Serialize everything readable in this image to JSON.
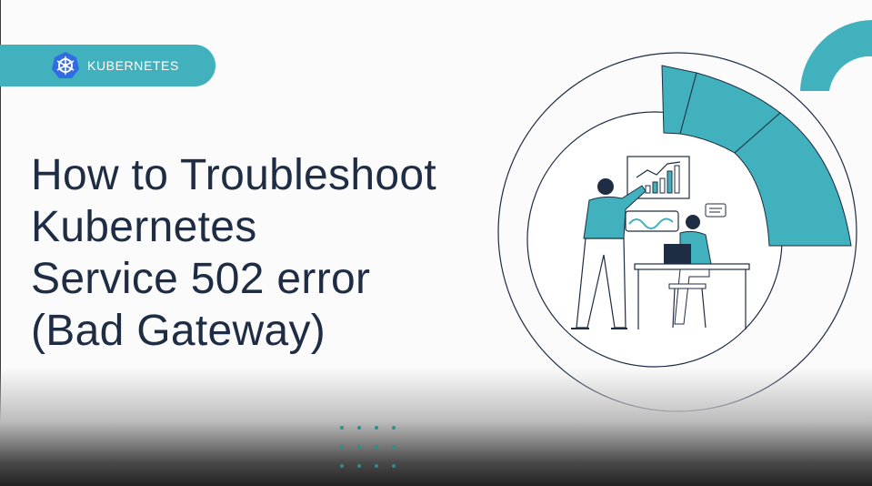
{
  "badge": {
    "label": "KUBERNETES",
    "icon": "kubernetes-helm-icon"
  },
  "title": {
    "line1": "How to Troubleshoot",
    "line2": "Kubernetes",
    "line3": "Service 502 error",
    "line4": "(Bad Gateway)"
  },
  "colors": {
    "accent": "#40b1bd",
    "title": "#1f2d44",
    "background": "#fbfbfb",
    "logo": "#326ce5"
  }
}
